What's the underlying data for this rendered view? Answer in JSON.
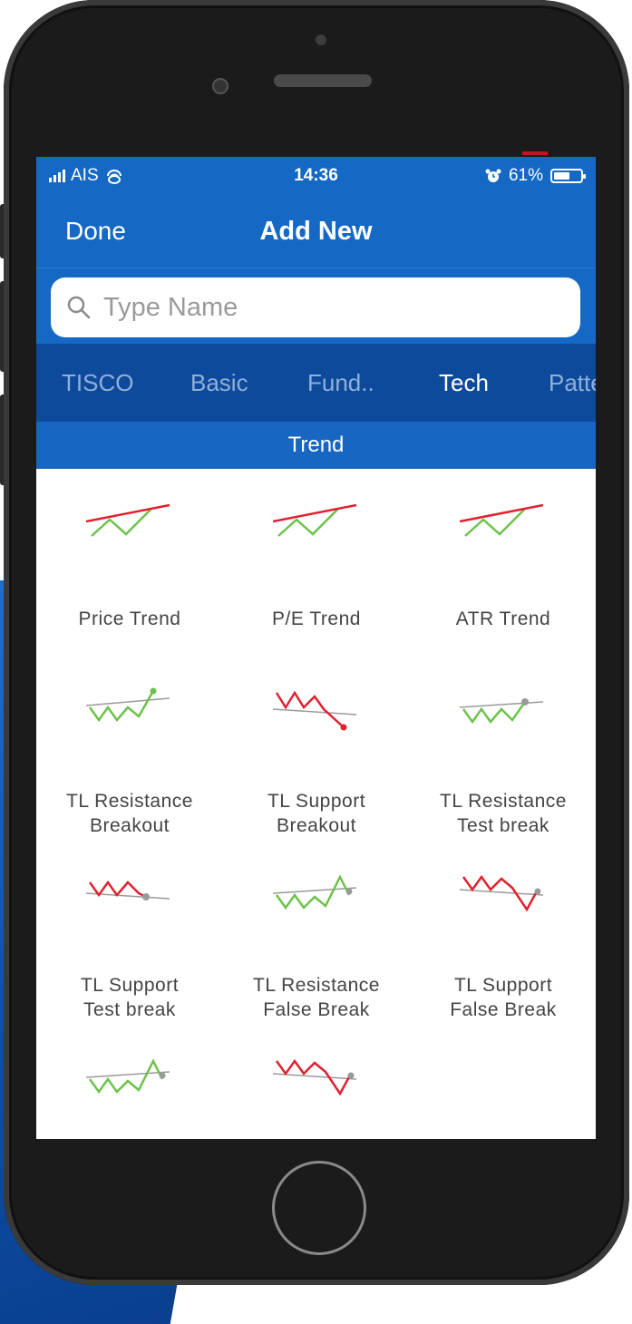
{
  "status_bar": {
    "carrier": "AIS",
    "time": "14:36",
    "battery": "61%",
    "battery_level": 0.61
  },
  "nav": {
    "done_label": "Done",
    "title": "Add New"
  },
  "search": {
    "placeholder": "Type Name"
  },
  "tabs": [
    {
      "label": "TISCO",
      "active": false
    },
    {
      "label": "Basic",
      "active": false
    },
    {
      "label": "Fund..",
      "active": false
    },
    {
      "label": "Tech",
      "active": true
    },
    {
      "label": "Patte",
      "active": false
    }
  ],
  "section_title": "Trend",
  "items": [
    {
      "line1": "Price Trend",
      "line2": "",
      "icon": "trendline-up-icon"
    },
    {
      "line1": "P/E Trend",
      "line2": "",
      "icon": "trendline-up-icon"
    },
    {
      "line1": "ATR Trend",
      "line2": "",
      "icon": "trendline-up-icon"
    },
    {
      "line1": "TL Resistance",
      "line2": "Breakout",
      "icon": "resistance-breakout-icon"
    },
    {
      "line1": "TL Support",
      "line2": "Breakout",
      "icon": "support-breakout-icon"
    },
    {
      "line1": "TL Resistance",
      "line2": "Test break",
      "icon": "resistance-test-icon"
    },
    {
      "line1": "TL Support",
      "line2": "Test break",
      "icon": "support-test-icon"
    },
    {
      "line1": "TL Resistance",
      "line2": "False Break",
      "icon": "resistance-false-break-icon"
    },
    {
      "line1": "TL Support",
      "line2": "False Break",
      "icon": "support-false-break-icon"
    },
    {
      "line1": "",
      "line2": "",
      "icon": "resistance-false-break-icon"
    },
    {
      "line1": "",
      "line2": "",
      "icon": "support-false-break-icon"
    }
  ],
  "colors": {
    "nav_blue": "#1569c4",
    "tab_blue": "#0e4a9c",
    "green": "#6cc24a",
    "red": "#e0212f",
    "gray_line": "#9a9a9a"
  }
}
